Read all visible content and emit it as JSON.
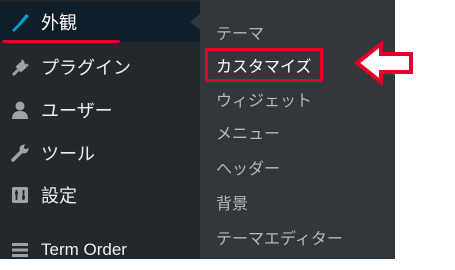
{
  "sidebar": {
    "items": [
      {
        "label": "外観",
        "icon": "paintbrush-icon",
        "active": true
      },
      {
        "label": "プラグイン",
        "icon": "plug-icon"
      },
      {
        "label": "ユーザー",
        "icon": "user-icon"
      },
      {
        "label": "ツール",
        "icon": "wrench-icon"
      },
      {
        "label": "設定",
        "icon": "settings-icon"
      },
      {
        "label": "Term Order",
        "icon": "list-icon"
      }
    ]
  },
  "submenu": {
    "items": [
      {
        "label": "テーマ"
      },
      {
        "label": "カスタマイズ",
        "highlighted": true
      },
      {
        "label": "ウィジェット"
      },
      {
        "label": "メニュー"
      },
      {
        "label": "ヘッダー"
      },
      {
        "label": "背景"
      },
      {
        "label": "テーマエディター"
      }
    ]
  },
  "colors": {
    "sidebar_bg": "#23282d",
    "submenu_bg": "#32373c",
    "active_icon": "#00a0d2",
    "highlight_red": "#e4002b"
  }
}
